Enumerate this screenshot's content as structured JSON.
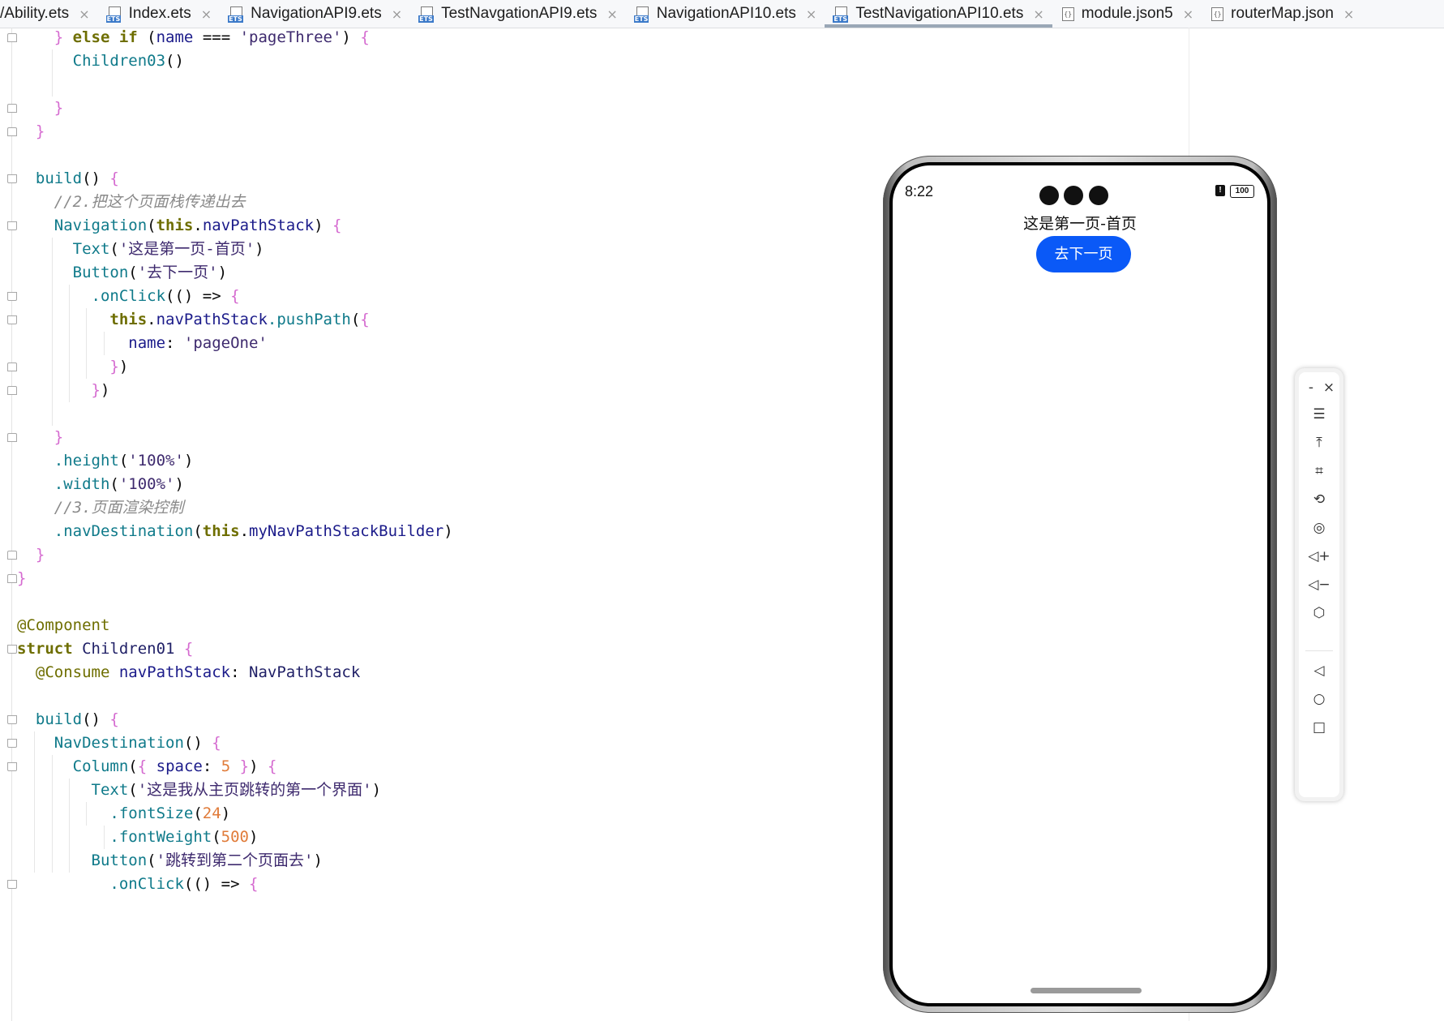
{
  "tabs": [
    {
      "label": "/Ability.ets",
      "icon": "none",
      "active": false
    },
    {
      "label": "Index.ets",
      "icon": "ets",
      "active": false
    },
    {
      "label": "NavigationAPI9.ets",
      "icon": "ets",
      "active": false
    },
    {
      "label": "TestNavgationAPI9.ets",
      "icon": "ets",
      "active": false
    },
    {
      "label": "NavigationAPI10.ets",
      "icon": "ets",
      "active": false
    },
    {
      "label": "TestNavigationAPI10.ets",
      "icon": "ets",
      "active": true
    },
    {
      "label": "module.json5",
      "icon": "json",
      "active": false
    },
    {
      "label": "routerMap.json",
      "icon": "json",
      "active": false
    }
  ],
  "tab_close_glyph": "×",
  "ets_icon_text": "ETS",
  "json_icon_text": "{}",
  "code_lines": [
    [
      [
        "p",
        "    } "
      ],
      [
        "k",
        "else if "
      ],
      [
        "",
        "("
      ],
      [
        "id",
        "name "
      ],
      [
        "",
        "=== "
      ],
      [
        "s",
        "'pageThree'"
      ],
      [
        "",
        ") "
      ],
      [
        "p",
        "{"
      ]
    ],
    [
      [
        "f",
        "      Children03"
      ],
      [
        "",
        "()"
      ]
    ],
    [
      [
        "",
        ""
      ]
    ],
    [
      [
        "p",
        "    }"
      ]
    ],
    [
      [
        "p",
        "  }"
      ]
    ],
    [
      [
        "",
        ""
      ]
    ],
    [
      [
        "f",
        "  build"
      ],
      [
        "",
        "() "
      ],
      [
        "p",
        "{"
      ]
    ],
    [
      [
        "c",
        "    //2.把这个页面栈传递出去"
      ]
    ],
    [
      [
        "f",
        "    Navigation"
      ],
      [
        "",
        "("
      ],
      [
        "k",
        "this"
      ],
      [
        "",
        "."
      ],
      [
        "id",
        "navPathStack"
      ],
      [
        "",
        ") "
      ],
      [
        "p",
        "{"
      ]
    ],
    [
      [
        "f",
        "      Text"
      ],
      [
        "",
        "("
      ],
      [
        "s",
        "'这是第一页-首页'"
      ],
      [
        "",
        ")"
      ]
    ],
    [
      [
        "f",
        "      Button"
      ],
      [
        "",
        "("
      ],
      [
        "s",
        "'去下一页'"
      ],
      [
        "",
        ")"
      ]
    ],
    [
      [
        "f",
        "        .onClick"
      ],
      [
        "",
        "(() => "
      ],
      [
        "p",
        "{"
      ]
    ],
    [
      [
        "k",
        "          this"
      ],
      [
        "",
        "."
      ],
      [
        "id",
        "navPathStack"
      ],
      [
        "f",
        ".pushPath"
      ],
      [
        "",
        "("
      ],
      [
        "p",
        "{"
      ]
    ],
    [
      [
        "id",
        "            name"
      ],
      [
        "",
        ": "
      ],
      [
        "s",
        "'pageOne'"
      ]
    ],
    [
      [
        "p",
        "          }"
      ],
      [
        "",
        ")"
      ]
    ],
    [
      [
        "p",
        "        }"
      ],
      [
        "",
        ")"
      ]
    ],
    [
      [
        "",
        ""
      ]
    ],
    [
      [
        "p",
        "    }"
      ]
    ],
    [
      [
        "f",
        "    .height"
      ],
      [
        "",
        "("
      ],
      [
        "s",
        "'100%'"
      ],
      [
        "",
        ")"
      ]
    ],
    [
      [
        "f",
        "    .width"
      ],
      [
        "",
        "("
      ],
      [
        "s",
        "'100%'"
      ],
      [
        "",
        ")"
      ]
    ],
    [
      [
        "c",
        "    //3.页面渲染控制"
      ]
    ],
    [
      [
        "f",
        "    .navDestination"
      ],
      [
        "",
        "("
      ],
      [
        "k",
        "this"
      ],
      [
        "",
        "."
      ],
      [
        "id",
        "myNavPathStackBuilder"
      ],
      [
        "",
        ")"
      ]
    ],
    [
      [
        "p",
        "  }"
      ]
    ],
    [
      [
        "p",
        "}"
      ]
    ],
    [
      [
        "",
        ""
      ]
    ],
    [
      [
        "ann",
        "@Component"
      ]
    ],
    [
      [
        "k",
        "struct "
      ],
      [
        "ty",
        "Children01 "
      ],
      [
        "p",
        "{"
      ]
    ],
    [
      [
        "ann",
        "  @Consume "
      ],
      [
        "id",
        "navPathStack"
      ],
      [
        "",
        ": "
      ],
      [
        "ty",
        "NavPathStack"
      ]
    ],
    [
      [
        "",
        ""
      ]
    ],
    [
      [
        "f",
        "  build"
      ],
      [
        "",
        "() "
      ],
      [
        "p",
        "{"
      ]
    ],
    [
      [
        "f",
        "    NavDestination"
      ],
      [
        "",
        "() "
      ],
      [
        "p",
        "{"
      ]
    ],
    [
      [
        "f",
        "      Column"
      ],
      [
        "",
        "("
      ],
      [
        "p",
        "{ "
      ],
      [
        "id",
        "space"
      ],
      [
        "",
        ": "
      ],
      [
        "n",
        "5 "
      ],
      [
        "p",
        "}"
      ],
      [
        "",
        ") "
      ],
      [
        "p",
        "{"
      ]
    ],
    [
      [
        "f",
        "        Text"
      ],
      [
        "",
        "("
      ],
      [
        "s",
        "'这是我从主页跳转的第一个界面'"
      ],
      [
        "",
        ")"
      ]
    ],
    [
      [
        "f",
        "          .fontSize"
      ],
      [
        "",
        "("
      ],
      [
        "n",
        "24"
      ],
      [
        "",
        ")"
      ]
    ],
    [
      [
        "f",
        "          .fontWeight"
      ],
      [
        "",
        "("
      ],
      [
        "n",
        "500"
      ],
      [
        "",
        ")"
      ]
    ],
    [
      [
        "f",
        "        Button"
      ],
      [
        "",
        "("
      ],
      [
        "s",
        "'跳转到第二个页面去'"
      ],
      [
        "",
        ")"
      ]
    ],
    [
      [
        "f",
        "          .onClick"
      ],
      [
        "",
        "(() => "
      ],
      [
        "p",
        "{"
      ]
    ]
  ],
  "device": {
    "time": "8:22",
    "battery": "100",
    "alert_glyph": "!",
    "text": "这是第一页-首页",
    "button_label": "去下一页",
    "button_color": "#0a59f7"
  },
  "emulator_toolbar": {
    "minimize": "-",
    "close": "×",
    "items": [
      {
        "name": "menu-icon",
        "glyph": "☰"
      },
      {
        "name": "pin-icon",
        "glyph": "⤒"
      },
      {
        "name": "crop-icon",
        "glyph": "⌗"
      },
      {
        "name": "rotate-icon",
        "glyph": "⟲"
      },
      {
        "name": "screenshot-icon",
        "glyph": "◎"
      },
      {
        "name": "volume-up-icon",
        "glyph": "◁+"
      },
      {
        "name": "volume-down-icon",
        "glyph": "◁−"
      },
      {
        "name": "shake-icon",
        "glyph": "⬡"
      },
      {
        "name": "back-icon",
        "glyph": "◁"
      },
      {
        "name": "home-icon",
        "glyph": "○"
      },
      {
        "name": "recents-icon",
        "glyph": "□"
      }
    ]
  }
}
